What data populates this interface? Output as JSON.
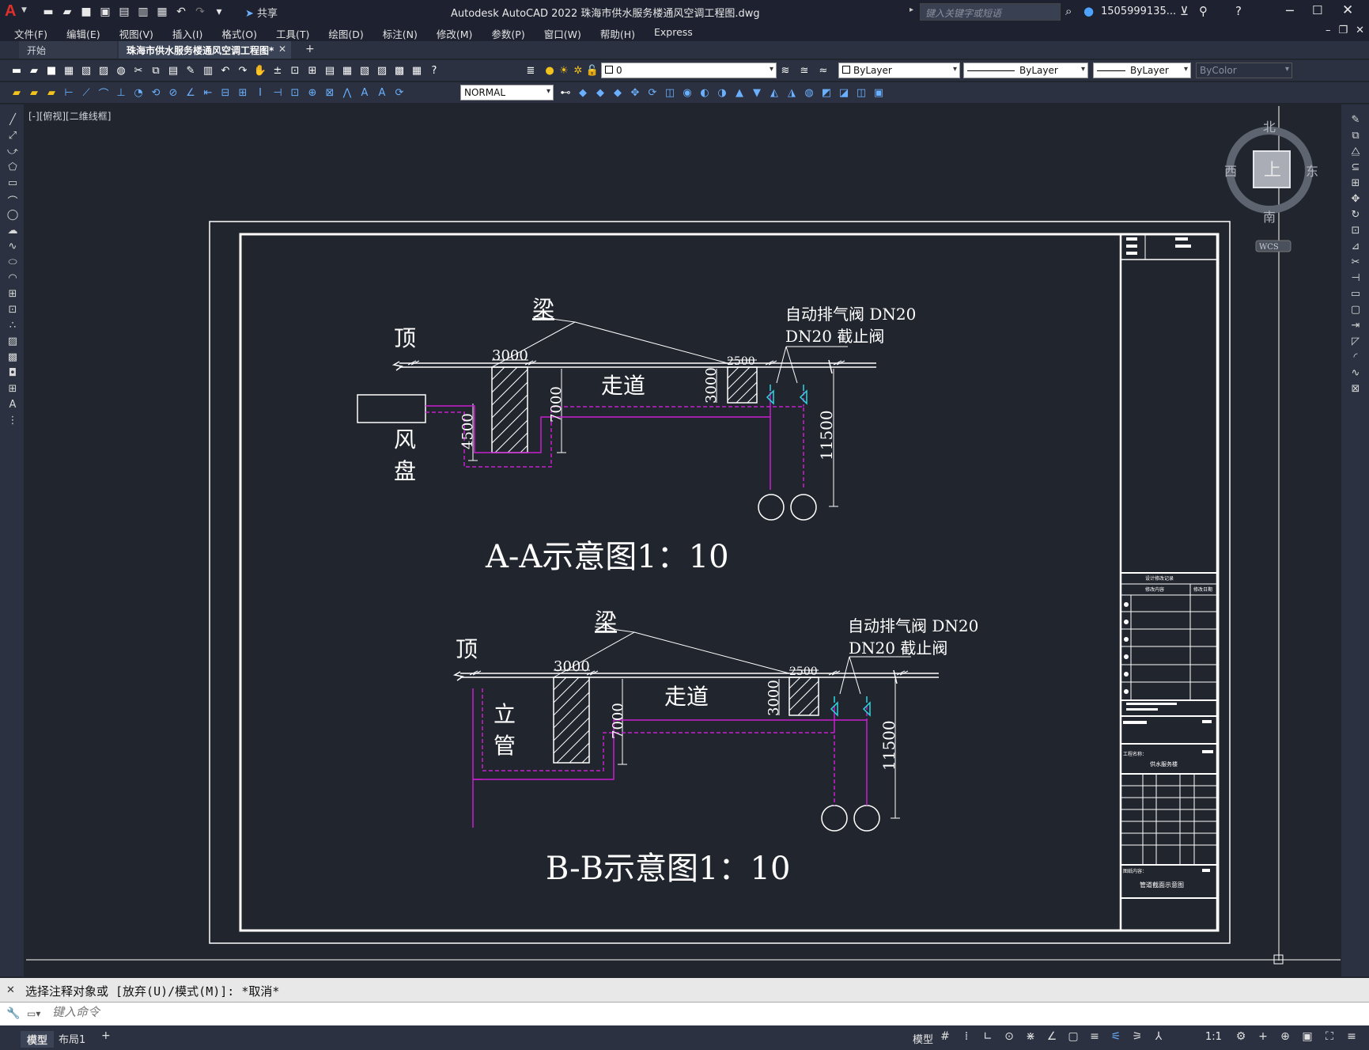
{
  "app": {
    "logo": "A",
    "title": "Autodesk AutoCAD 2022    珠海市供水服务楼通风空调工程图.dwg",
    "share_label": "共享",
    "search_placeholder": "键入关键字或短语",
    "user_name": "1505999135...",
    "icons": [
      "new-icon",
      "open-icon",
      "save-icon",
      "saveas-icon",
      "open-web-icon",
      "save-web-icon",
      "plot-icon",
      "undo-icon",
      "redo-icon"
    ]
  },
  "menu": {
    "items": [
      "文件(F)",
      "编辑(E)",
      "视图(V)",
      "插入(I)",
      "格式(O)",
      "工具(T)",
      "绘图(D)",
      "标注(N)",
      "修改(M)",
      "参数(P)",
      "窗口(W)",
      "帮助(H)",
      "Express"
    ]
  },
  "tabs": {
    "start": "开始",
    "drawing": "珠海市供水服务楼通风空调工程图*"
  },
  "toolbar": {
    "layer_value": "0",
    "color_value": "ByLayer",
    "linetype_value": "ByLayer",
    "lineweight_value": "ByLayer",
    "plotstyle_value": "ByColor",
    "textstyle_value": "NORMAL"
  },
  "viewport": {
    "label": "[-][俯视][二维线框]",
    "viewcube": {
      "top": "上",
      "north": "北",
      "south": "南",
      "east": "东",
      "west": "西",
      "wcs": "WCS"
    }
  },
  "drawing": {
    "colors": {
      "line": "#ffffff",
      "pipe": "#c81ecf",
      "valve": "#2ad8e0",
      "bg": "#21252e"
    },
    "section_a": {
      "top_label": "顶",
      "beam_label": "梁",
      "corridor": "走道",
      "fan_coil": [
        "风",
        "盘"
      ],
      "valve_note_1": "自动排气阀 DN20",
      "valve_note_2": "DN20 截止阀",
      "dim_3000_top": "3000",
      "dim_2500": "2500",
      "dim_3000_side": "3000",
      "dim_7000": "7000",
      "dim_4500": "4500",
      "dim_11500": "11500",
      "caption": "A-A示意图1：10"
    },
    "section_b": {
      "top_label": "顶",
      "beam_label": "梁",
      "corridor": "走道",
      "riser": [
        "立",
        "管"
      ],
      "valve_note_1": "自动排气阀 DN20",
      "valve_note_2": "DN20 截止阀",
      "dim_3000_top": "3000",
      "dim_2500": "2500",
      "dim_3000_side": "3000",
      "dim_7000": "7000",
      "dim_11500": "11500",
      "caption": "B-B示意图1：10"
    },
    "titleblock": {
      "revision_header": "设计修改记录",
      "rev_col_1": "修改内容",
      "rev_col_2": "修改日期",
      "project_label": "工程名称：",
      "project_name": "供水服务楼",
      "drawing_label": "图纸内容：",
      "drawing_name": "管道截面示意图"
    }
  },
  "command": {
    "history": "选择注释对象或 [放弃(U)/模式(M)]: *取消*",
    "placeholder": "键入命令"
  },
  "status": {
    "layout_tabs": [
      "模型",
      "布局1"
    ],
    "model_label": "模型",
    "annotation_scale": "1:1"
  }
}
